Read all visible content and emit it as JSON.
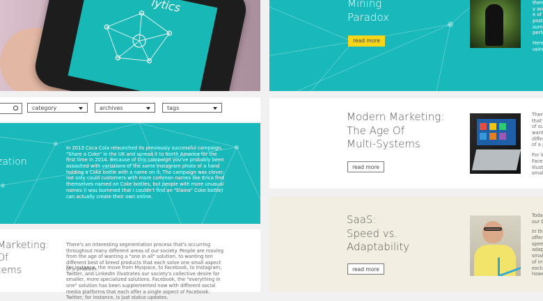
{
  "filters": {
    "category": "category",
    "archives": "archives",
    "tags": "tags"
  },
  "hero": {
    "phone_text": "lytics"
  },
  "teal_left": {
    "title_fragment": "zation",
    "body": "In 2013 Coca Cola relaunched its previously successful campaign, \"Share a Coke\" in the UK and spread it to North America for the first time in 2014. Because of this campaign you've probably been assaulted with variations of the same Instagram photo of a hand holding a Coke bottle with a name on it. The campaign was clever; not only could customers with more common names like Erica find themselves named on Coke bottles, but people with more unusual names (I was bummed that I couldn't find an \"Elaina\" Coke bottle) can actually create their own online."
  },
  "left_article": {
    "title_lines": [
      "Marketing:",
      "Of",
      "tems"
    ],
    "para1": "There's an interesting segmentation process that's occurring throughout many different areas of our society. People are moving from the age of wanting a \"one in all\" solution, to wanting ten different best of breed products that each solve one small aspect of a problem.",
    "para2": "For instance, the move from Myspace, to Facebook, to Instagram, Twitter, and LinkedIn illustrates our society's collective desire for smaller, more specialized solutions. Facebook, the \"everything in one\" solution has been supplemented now with different social media platforms that each offer a single aspect of Facebook. Twitter, for instance, is just status updates."
  },
  "card_top": {
    "title_lines": [
      "Mining",
      "Paradox"
    ],
    "button": "read more",
    "excerpt": [
      "there",
      "y and",
      "e of",
      "posts",
      "summ",
      "perfo",
      "",
      "Here",
      "using"
    ]
  },
  "card_mid": {
    "title_lines": [
      "Modern Marketing:",
      "The Age Of",
      "Multi-Systems"
    ],
    "button": "read more",
    "excerpt": [
      "There",
      "that's",
      "of our",
      "wantir",
      "differ",
      "of a p",
      "",
      "For in",
      "Faceb",
      "illustr",
      "small"
    ]
  },
  "card_bottom": {
    "title_lines": [
      "SaaS:",
      "Speed vs.",
      "Adaptability"
    ],
    "button": "read more",
    "excerpt": [
      "Today",
      "our D",
      "",
      "In the",
      "offeri",
      "speed",
      "adapt",
      "small",
      "of im",
      "exclu",
      "howe"
    ]
  },
  "colors": {
    "teal": "#19b9bb",
    "yellow": "#f5d61b",
    "cream": "#f2efe2"
  }
}
